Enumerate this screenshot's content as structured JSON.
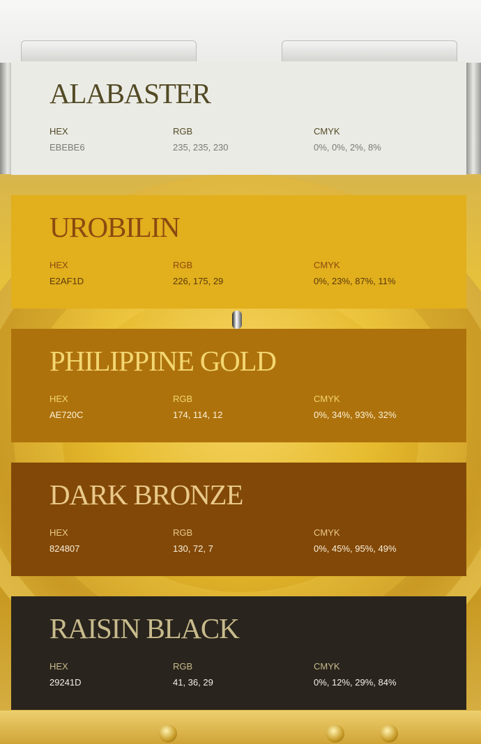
{
  "swatches": [
    {
      "name": "ALABASTER",
      "hex_label": "HEX",
      "hex": "EBEBE6",
      "rgb_label": "RGB",
      "rgb": "235, 235, 230",
      "cmyk_label": "CMYK",
      "cmyk": "0%, 0%, 2%, 8%",
      "bg_color": "#EBEBE6",
      "title_color": "#524a24",
      "label_color": "#524a24",
      "value_color": "#7a7a74"
    },
    {
      "name": "UROBILIN",
      "hex_label": "HEX",
      "hex": "E2AF1D",
      "rgb_label": "RGB",
      "rgb": "226, 175, 29",
      "cmyk_label": "CMYK",
      "cmyk": "0%, 23%, 87%, 11%",
      "bg_color": "#E2AF1D",
      "title_color": "#8a4a10",
      "label_color": "#8a4a10",
      "value_color": "#5a3a0c"
    },
    {
      "name": "PHILIPPINE GOLD",
      "hex_label": "HEX",
      "hex": "AE720C",
      "rgb_label": "RGB",
      "rgb": "174, 114, 12",
      "cmyk_label": "CMYK",
      "cmyk": "0%, 34%, 93%, 32%",
      "bg_color": "#AE720C",
      "title_color": "#f3d671",
      "label_color": "#f3d671",
      "value_color": "#fbf2d8"
    },
    {
      "name": "DARK BRONZE",
      "hex_label": "HEX",
      "hex": "824807",
      "rgb_label": "RGB",
      "rgb": "130, 72, 7",
      "cmyk_label": "CMYK",
      "cmyk": "0%, 45%, 95%, 49%",
      "bg_color": "#824807",
      "title_color": "#e9c98a",
      "label_color": "#e9c98a",
      "value_color": "#fbf0dc"
    },
    {
      "name": "RAISIN BLACK",
      "hex_label": "HEX",
      "hex": "29241D",
      "rgb_label": "RGB",
      "rgb": "41, 36, 29",
      "cmyk_label": "CMYK",
      "cmyk": "0%, 12%, 29%, 84%",
      "bg_color": "#29241D",
      "title_color": "#c8bb8c",
      "label_color": "#c8bb8c",
      "value_color": "#f3f0ea"
    }
  ]
}
